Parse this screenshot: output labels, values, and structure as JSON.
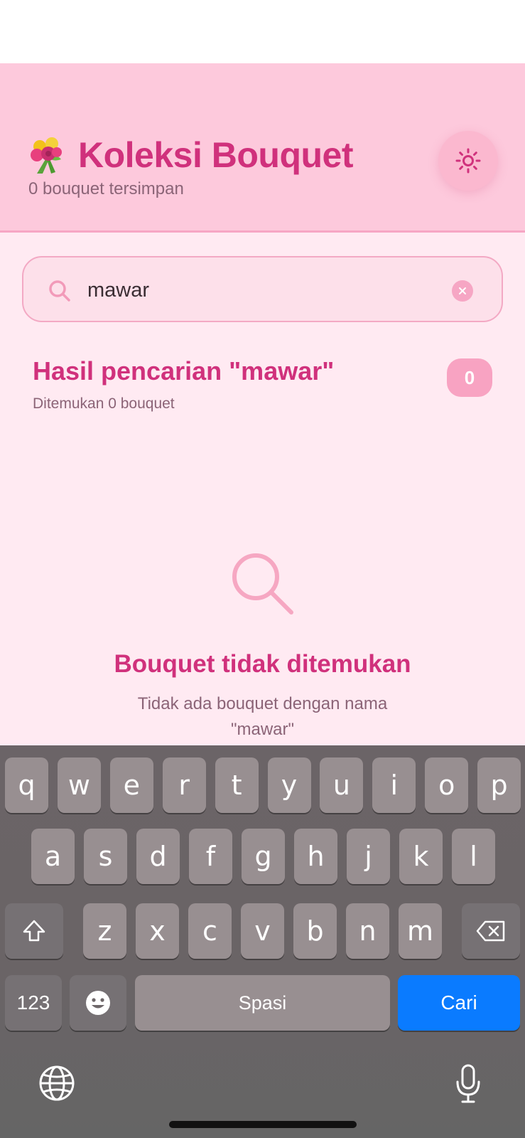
{
  "header": {
    "title": "Koleksi Bouquet",
    "subtitle": "0 bouquet tersimpan",
    "icons": {
      "bouquet": "bouquet-icon",
      "theme": "sun-icon"
    }
  },
  "search": {
    "value": "mawar",
    "icon": "search-icon",
    "clear_icon": "close-icon"
  },
  "results": {
    "title": "Hasil pencarian \"mawar\"",
    "subtitle": "Ditemukan 0 bouquet",
    "count": "0"
  },
  "empty_state": {
    "icon": "search-icon",
    "title": "Bouquet tidak ditemukan",
    "message": "Tidak ada bouquet dengan nama \"mawar\""
  },
  "keyboard": {
    "row1": [
      "q",
      "w",
      "e",
      "r",
      "t",
      "y",
      "u",
      "i",
      "o",
      "p"
    ],
    "row2": [
      "a",
      "s",
      "d",
      "f",
      "g",
      "h",
      "j",
      "k",
      "l"
    ],
    "row3": [
      "z",
      "x",
      "c",
      "v",
      "b",
      "n",
      "m"
    ],
    "numbers_label": "123",
    "space_label": "Spasi",
    "search_label": "Cari"
  },
  "colors": {
    "accent": "#d0317c",
    "header_bg": "#fdc9dc",
    "page_bg": "#ffeaf2",
    "search_key": "#0a7bff"
  }
}
